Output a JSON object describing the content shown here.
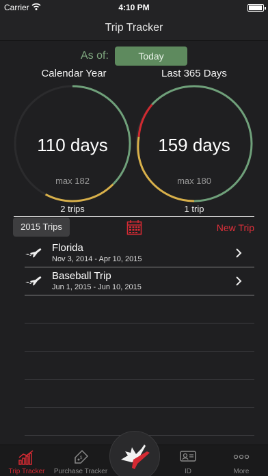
{
  "status_bar": {
    "carrier": "Carrier",
    "time": "4:10 PM"
  },
  "nav": {
    "title": "Trip Tracker"
  },
  "as_of": {
    "label": "As of:",
    "button": "Today"
  },
  "summary": {
    "calendar_year": {
      "title": "Calendar Year",
      "days": "110 days",
      "max": "max 182",
      "trips": "2 trips",
      "fraction": 0.604
    },
    "last_365": {
      "title": "Last 365 Days",
      "days": "159 days",
      "max": "max 180",
      "trips": "1 trip",
      "fraction": 0.883
    }
  },
  "toolbar": {
    "year_button": "2015 Trips",
    "new_trip": "New Trip"
  },
  "trips": [
    {
      "name": "Florida",
      "dates": "Nov 3, 2014 - Apr 10, 2015"
    },
    {
      "name": "Baseball Trip",
      "dates": "Jun 1, 2015 - Jun 10, 2015"
    }
  ],
  "tabs": [
    {
      "label": "Trip Tracker",
      "icon": "chart-icon"
    },
    {
      "label": "Purchase Tracker",
      "icon": "price-tag-icon"
    },
    {
      "label": "",
      "icon": "maple-leaf-plane-icon"
    },
    {
      "label": "ID",
      "icon": "id-card-icon"
    },
    {
      "label": "More",
      "icon": "more-dots-icon"
    }
  ],
  "colors": {
    "accent_red": "#d42a33",
    "ring_green": "#6fa07a",
    "ring_yellow": "#d8b04a",
    "ring_track": "#2b2b2d"
  }
}
